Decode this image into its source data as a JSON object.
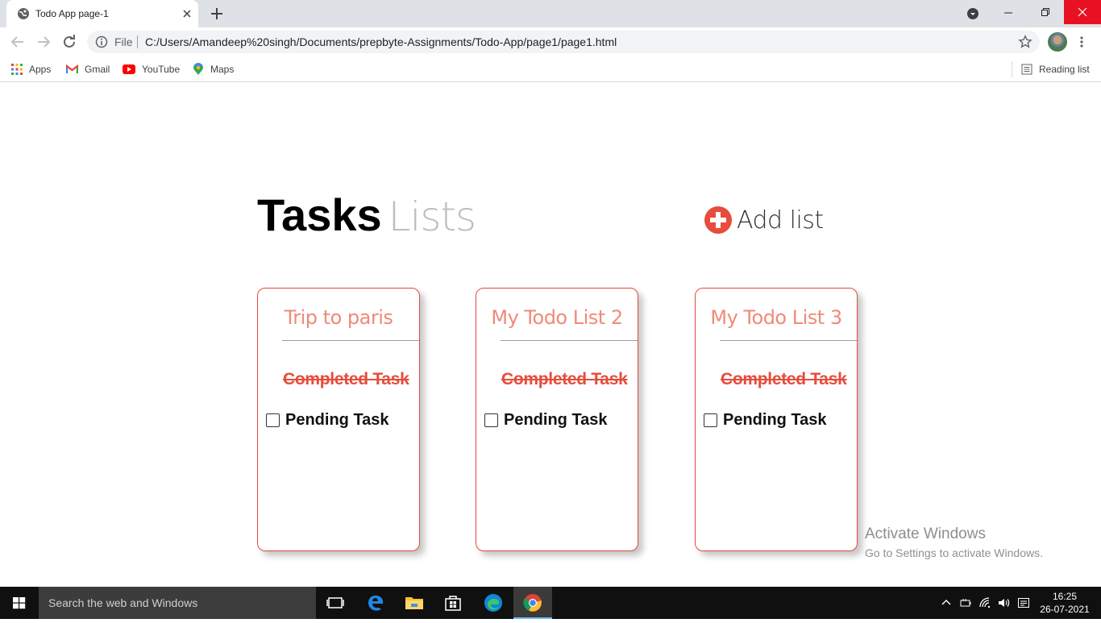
{
  "browser": {
    "tab_title": "Todo App page-1",
    "address_scheme": "File",
    "address_url": "C:/Users/Amandeep%20singh/Documents/prepbyte-Assignments/Todo-App/page1/page1.html",
    "bookmarks": [
      {
        "label": "Apps",
        "icon": "apps-grid-icon"
      },
      {
        "label": "Gmail",
        "icon": "gmail-icon"
      },
      {
        "label": "YouTube",
        "icon": "youtube-icon"
      },
      {
        "label": "Maps",
        "icon": "maps-icon"
      }
    ],
    "reading_list": "Reading list"
  },
  "app": {
    "title_bold": "Tasks",
    "title_light": "Lists",
    "add_list_label": "Add list",
    "accent_color": "#e74c3c",
    "lists": [
      {
        "title": "Trip to paris",
        "completed": "Completed Task",
        "pending": "Pending Task",
        "pending_checked": false
      },
      {
        "title": "My Todo List 2",
        "completed": "Completed Task",
        "pending": "Pending Task",
        "pending_checked": false
      },
      {
        "title": "My Todo List 3",
        "completed": "Completed Task",
        "pending": "Pending Task",
        "pending_checked": false
      }
    ]
  },
  "watermark": {
    "line1": "Activate Windows",
    "line2": "Go to Settings to activate Windows."
  },
  "taskbar": {
    "search_placeholder": "Search the web and Windows",
    "time": "16:25",
    "date": "26-07-2021"
  }
}
